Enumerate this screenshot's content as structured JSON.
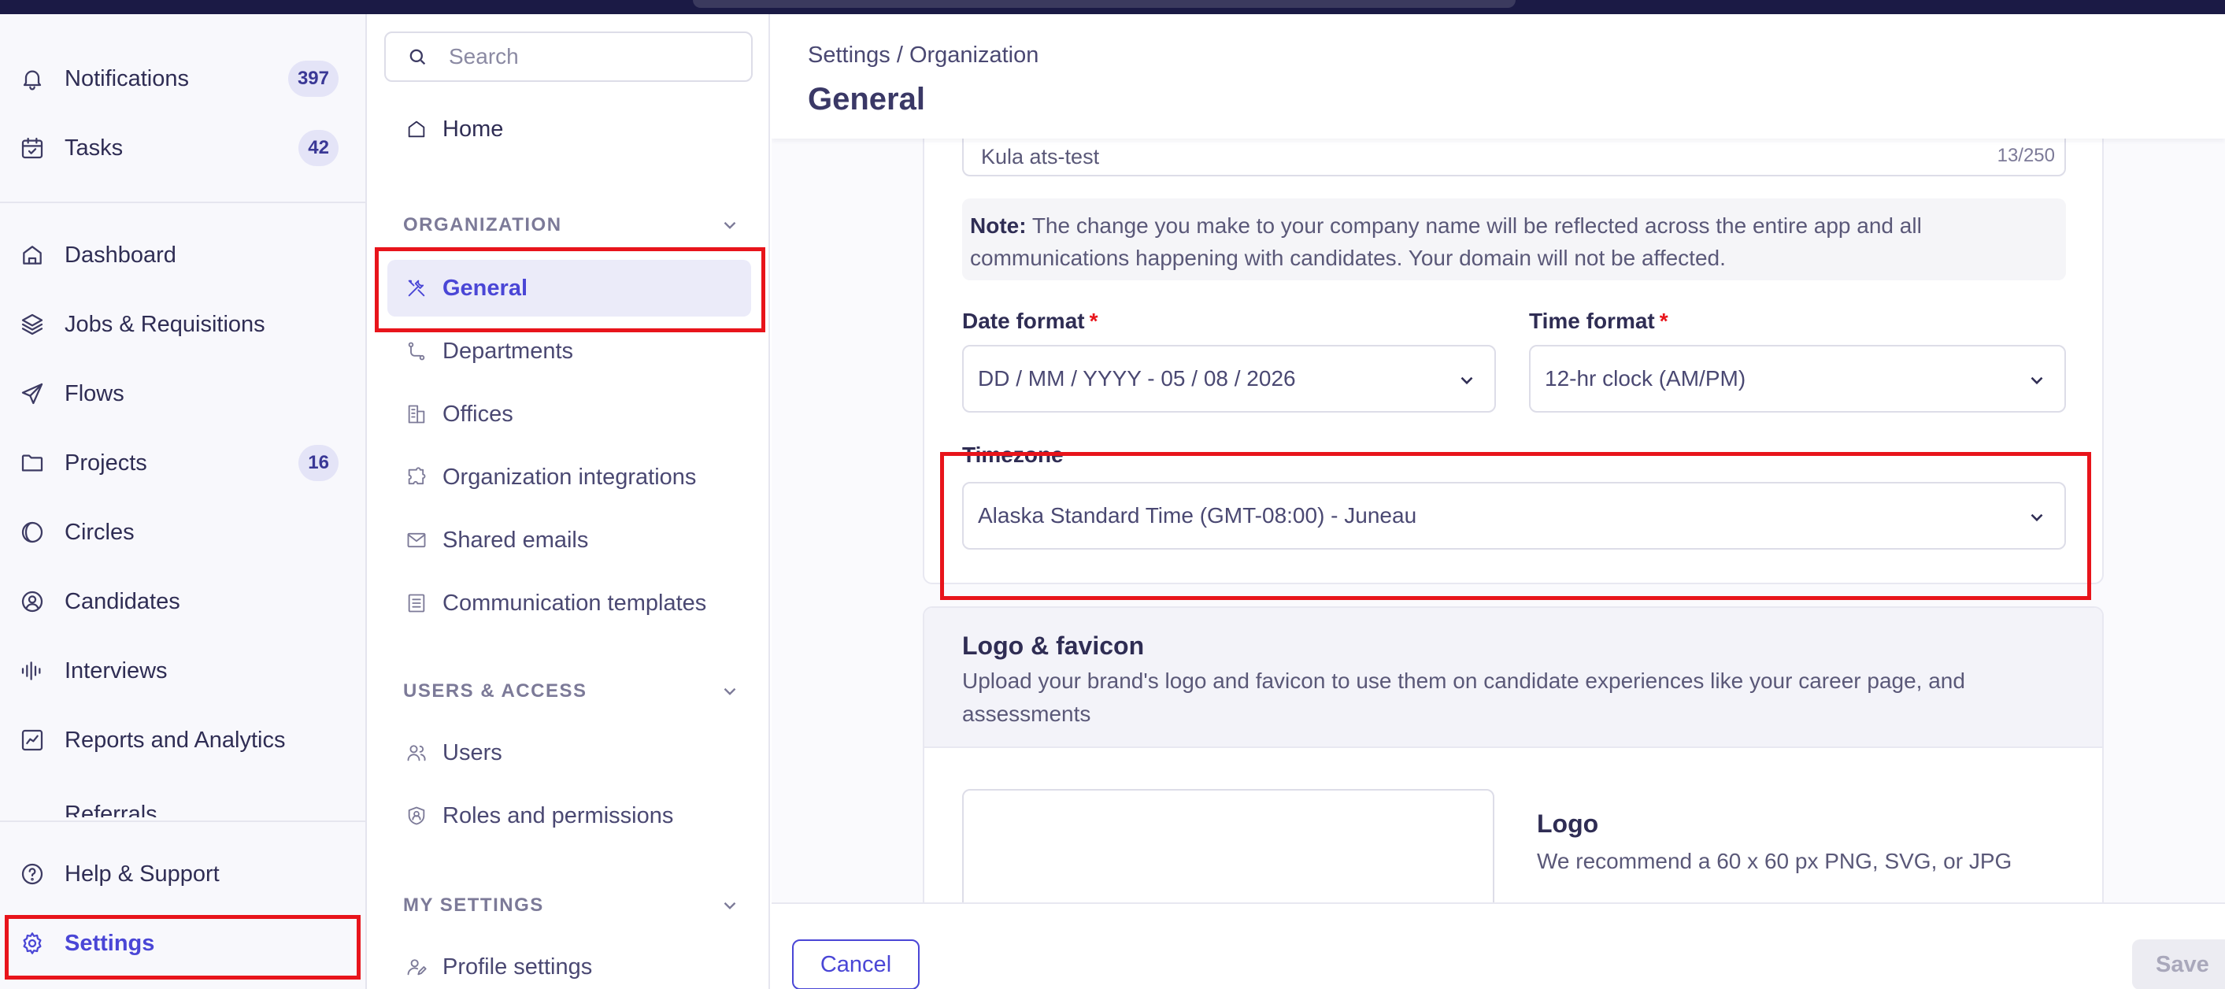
{
  "nav": {
    "items": [
      {
        "label": "Notifications",
        "badge": "397",
        "icon": "bell-icon"
      },
      {
        "label": "Tasks",
        "badge": "42",
        "icon": "calendar-check-icon"
      },
      {
        "label": "Dashboard",
        "icon": "home-icon"
      },
      {
        "label": "Jobs & Requisitions",
        "icon": "layers-icon"
      },
      {
        "label": "Flows",
        "icon": "send-icon"
      },
      {
        "label": "Projects",
        "badge": "16",
        "icon": "folder-icon"
      },
      {
        "label": "Circles",
        "icon": "circles-icon"
      },
      {
        "label": "Candidates",
        "icon": "user-circle-icon"
      },
      {
        "label": "Interviews",
        "icon": "audio-wave-icon"
      },
      {
        "label": "Reports and Analytics",
        "icon": "chart-icon"
      },
      {
        "label": "Referrals",
        "icon": "partial-hidden"
      }
    ],
    "bottom": [
      {
        "label": "Help & Support",
        "icon": "help-circle-icon"
      },
      {
        "label": "Settings",
        "icon": "gear-icon"
      }
    ]
  },
  "settings_nav": {
    "search_placeholder": "Search",
    "home": "Home",
    "sections": [
      {
        "title": "ORGANIZATION",
        "items": [
          "General",
          "Departments",
          "Offices",
          "Organization integrations",
          "Shared emails",
          "Communication templates"
        ]
      },
      {
        "title": "USERS & ACCESS",
        "items": [
          "Users",
          "Roles and permissions"
        ]
      },
      {
        "title": "MY SETTINGS",
        "items": [
          "Profile settings"
        ]
      }
    ],
    "active": "General"
  },
  "header": {
    "breadcrumb": "Settings / Organization",
    "title": "General"
  },
  "form": {
    "company_name_value": "Kula ats-test",
    "company_name_count": "13/250",
    "note_label": "Note:",
    "note_text": "The change you make to your company name will be reflected across the entire app and all communications happening with candidates. Your domain will not be affected.",
    "date_format_label": "Date format",
    "date_format_value": "DD / MM / YYYY - 05 / 08 / 2026",
    "time_format_label": "Time format",
    "time_format_value": "12-hr clock (AM/PM)",
    "required_mark": "*",
    "timezone_label": "Timezone",
    "timezone_value": "Alaska Standard Time (GMT-08:00) - Juneau"
  },
  "logo_section": {
    "title": "Logo & favicon",
    "description": "Upload your brand's logo and favicon to use them on candidate experiences like your career page, and assessments",
    "logo_title": "Logo",
    "logo_desc": "We recommend a 60 x 60 px PNG, SVG, or JPG"
  },
  "footer": {
    "cancel": "Cancel",
    "save": "Save"
  },
  "colors": {
    "accent": "#4a46d6",
    "highlight": "#e8141b",
    "badge_bg": "#e4e4f7"
  }
}
